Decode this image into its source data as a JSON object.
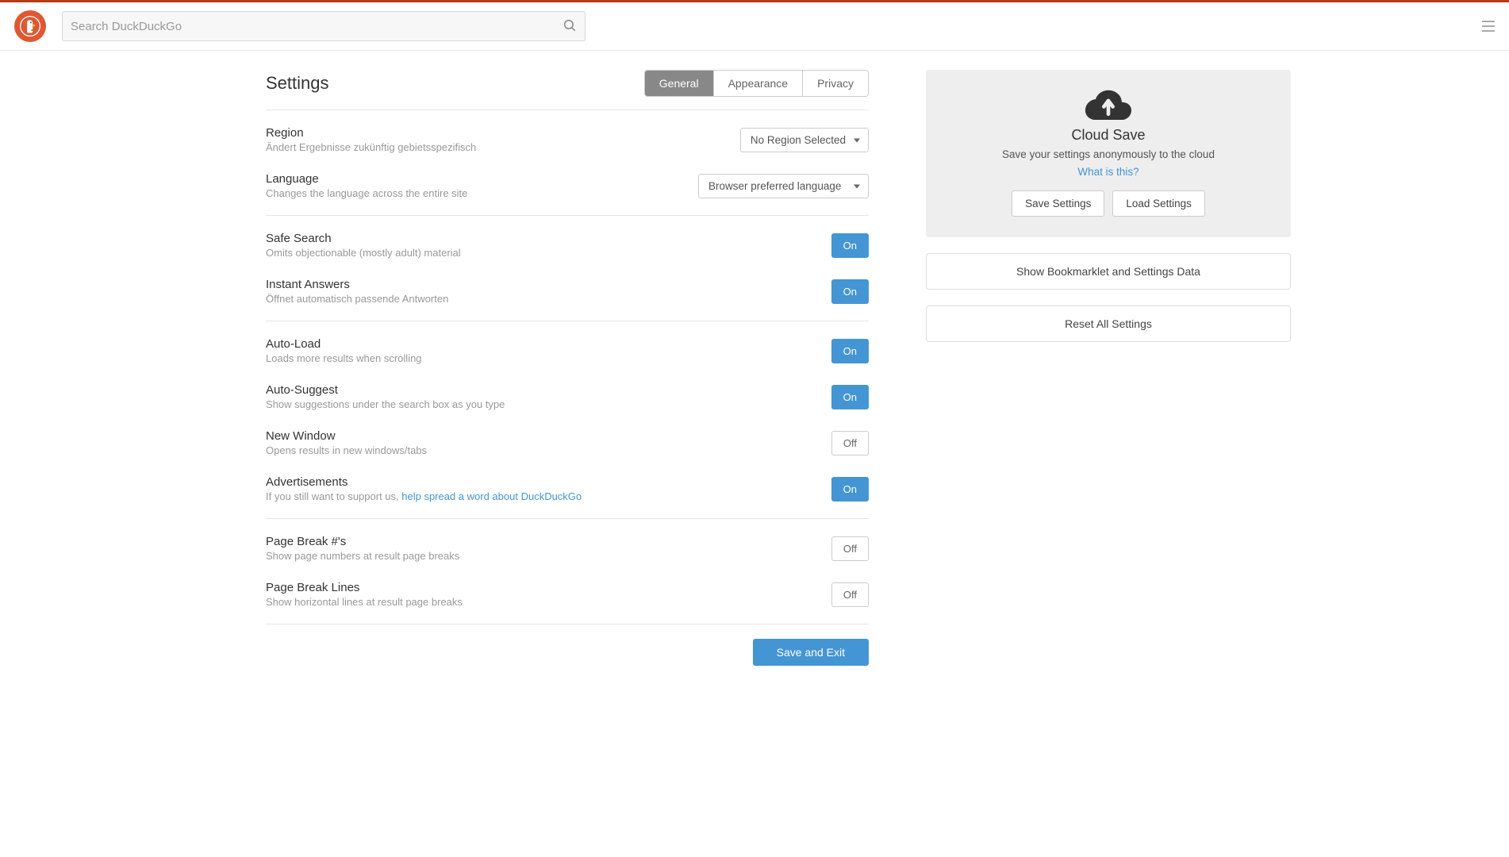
{
  "search": {
    "placeholder": "Search DuckDuckGo"
  },
  "title": "Settings",
  "tabs": {
    "general": "General",
    "appearance": "Appearance",
    "privacy": "Privacy"
  },
  "region": {
    "label": "Region",
    "desc": "Ändert Ergebnisse zukünftig gebietsspezifisch",
    "value": "No Region Selected"
  },
  "language": {
    "label": "Language",
    "desc": "Changes the language across the entire site",
    "value": "Browser preferred language"
  },
  "safe_search": {
    "label": "Safe Search",
    "desc": "Omits objectionable (mostly adult) material",
    "state": "On"
  },
  "instant_answers": {
    "label": "Instant Answers",
    "desc": "Öffnet automatisch passende Antworten",
    "state": "On"
  },
  "auto_load": {
    "label": "Auto-Load",
    "desc": "Loads more results when scrolling",
    "state": "On"
  },
  "auto_suggest": {
    "label": "Auto-Suggest",
    "desc": "Show suggestions under the search box as you type",
    "state": "On"
  },
  "new_window": {
    "label": "New Window",
    "desc": "Opens results in new windows/tabs",
    "state": "Off"
  },
  "ads": {
    "label": "Advertisements",
    "desc_prefix": "If you still want to support us, ",
    "desc_link": "help spread a word about DuckDuckGo",
    "state": "On"
  },
  "page_break_nums": {
    "label": "Page Break #'s",
    "desc": "Show page numbers at result page breaks",
    "state": "Off"
  },
  "page_break_lines": {
    "label": "Page Break Lines",
    "desc": "Show horizontal lines at result page breaks",
    "state": "Off"
  },
  "save_exit": "Save and Exit",
  "cloud": {
    "title": "Cloud Save",
    "desc": "Save your settings anonymously to the cloud",
    "link": "What is this?",
    "save": "Save Settings",
    "load": "Load Settings"
  },
  "bookmarklet": "Show Bookmarklet and Settings Data",
  "reset": "Reset All Settings"
}
